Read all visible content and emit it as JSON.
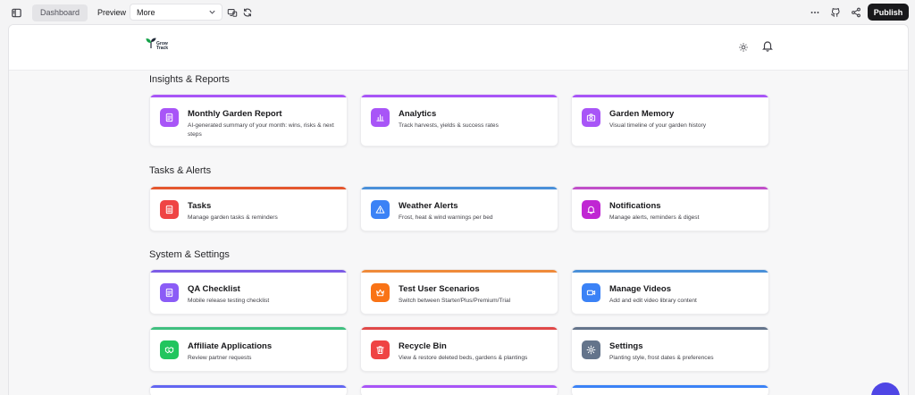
{
  "toolbar": {
    "tabs": [
      "Dashboard",
      "Preview"
    ],
    "more_select": "More",
    "publish_label": "Publish",
    "icons": [
      "sidebar-toggle-icon",
      "device-preview-icon",
      "refresh-icon",
      "more-horizontal-icon",
      "github-icon",
      "share-icon"
    ]
  },
  "header": {
    "logo_text": [
      "Grow",
      "Track"
    ],
    "icons": [
      "sun-icon",
      "bell-icon"
    ]
  },
  "sections": [
    {
      "title": "Insights & Reports",
      "cards": [
        {
          "title": "Monthly Garden Report",
          "desc": "AI-generated summary of your month: wins, risks & next steps",
          "icon": "report-icon",
          "color": "#a855f7",
          "bar": "#a855f7"
        },
        {
          "title": "Analytics",
          "desc": "Track harvests, yields & success rates",
          "icon": "bar-chart-icon",
          "color": "#a855f7",
          "bar": "#a855f7"
        },
        {
          "title": "Garden Memory",
          "desc": "Visual timeline of your garden history",
          "icon": "camera-icon",
          "color": "#a855f7",
          "bar": "#a855f7"
        }
      ]
    },
    {
      "title": "Tasks & Alerts",
      "cards": [
        {
          "title": "Tasks",
          "desc": "Manage garden tasks & reminders",
          "icon": "task-list-icon",
          "color": "#ef4444",
          "bar": "#e4572e"
        },
        {
          "title": "Weather Alerts",
          "desc": "Frost, heat & wind warnings per bed",
          "icon": "warning-triangle-icon",
          "color": "#3b82f6",
          "bar": "#4a90d9"
        },
        {
          "title": "Notifications",
          "desc": "Manage alerts, reminders & digest",
          "icon": "bell-icon",
          "color": "#c026d3",
          "bar": "#c14fc9"
        }
      ]
    },
    {
      "title": "System & Settings",
      "cards": [
        {
          "title": "QA Checklist",
          "desc": "Mobile release testing checklist",
          "icon": "checklist-icon",
          "color": "#8b5cf6",
          "bar": "#7c5ce6"
        },
        {
          "title": "Test User Scenarios",
          "desc": "Switch between Starter/Plus/Premium/Trial",
          "icon": "crown-icon",
          "color": "#f97316",
          "bar": "#ef8a3a"
        },
        {
          "title": "Manage Videos",
          "desc": "Add and edit video library content",
          "icon": "video-icon",
          "color": "#3b82f6",
          "bar": "#4a90d9"
        },
        {
          "title": "Affiliate Applications",
          "desc": "Review partner requests",
          "icon": "handshake-icon",
          "color": "#22c55e",
          "bar": "#3fbf7f"
        },
        {
          "title": "Recycle Bin",
          "desc": "View & restore deleted beds, gardens & plantings",
          "icon": "trash-icon",
          "color": "#ef4444",
          "bar": "#e04848"
        },
        {
          "title": "Settings",
          "desc": "Planting style, frost dates & preferences",
          "icon": "gear-icon",
          "color": "#64748b",
          "bar": "#64748b"
        }
      ]
    }
  ],
  "peek_bars": [
    "#6366f1",
    "#a855f7",
    "#3b82f6"
  ]
}
